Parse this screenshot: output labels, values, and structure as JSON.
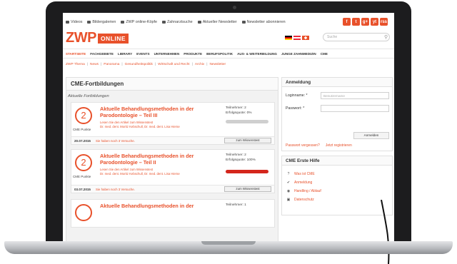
{
  "toplinks": [
    {
      "icon": "video-icon",
      "label": "Videos"
    },
    {
      "icon": "camera-icon",
      "label": "Bildergalerien"
    },
    {
      "icon": "user-icon",
      "label": "ZWP online-Köpfe"
    },
    {
      "icon": "search-icon",
      "label": "Zahnarztsuche"
    },
    {
      "icon": "mail-icon",
      "label": "Aktueller Newsletter"
    },
    {
      "icon": "mail-icon",
      "label": "Newsletter abonnieren"
    }
  ],
  "socials": [
    "f",
    "t",
    "g+",
    "yt",
    "rss"
  ],
  "logo": {
    "text": "ZWP",
    "badge": "ONLINE"
  },
  "search": {
    "placeholder": "Suche"
  },
  "nav": {
    "active": "STARTSEITE",
    "items": [
      "FACHGEBIETE",
      "LIBRARY",
      "EVENTS",
      "UNTERNEHMEN",
      "PRODUKTE",
      "BERUFSPOLITIK",
      "AUS- & WEITERBILDUNG",
      "JUNGE ZAHNMEDIZIN",
      "CME"
    ]
  },
  "subnav": [
    "ZWP Thema",
    "News",
    "Panorama",
    "Gesundheitspolitik",
    "Wirtschaft und Recht",
    "Archiv",
    "Newsletter"
  ],
  "main": {
    "title": "CME-Fortbildungen",
    "subtitle": "Aktuelle Fortbildungen"
  },
  "courses": [
    {
      "points": "2",
      "points_label": "CME Punkte",
      "title": "Aktuelle Behandlungsmethoden in der Parodontologie – Teil III",
      "link": "Lesen Sie den Artikel zum Wissenstest",
      "authors": "Dr. med. dent. Moritz Kebschull, Dr. med. dent. Lisa Hierse",
      "participants": "Teilnehmer: 2",
      "success": "Erfolgsquote: 0%",
      "success_value": 0,
      "date": "20.07.2015",
      "tries": "Sie haben noch 3 Versuche.",
      "button": "zum Wissenstest"
    },
    {
      "points": "2",
      "points_label": "CME Punkte",
      "title": "Aktuelle Behandlungsmethoden in der Parodontologie – Teil II",
      "link": "Lesen Sie den Artikel zum Wissenstest",
      "authors": "Dr. med. dent. Moritz Kebschull, Dr. med. dent. Lisa Hierse",
      "participants": "Teilnehmer: 2",
      "success": "Erfolgsquote: 100%",
      "success_value": 100,
      "date": "03.07.2015",
      "tries": "Sie haben noch 3 Versuche.",
      "button": "zum Wissenstest"
    },
    {
      "points": "",
      "points_label": "",
      "title": "Aktuelle Behandlungsmethoden in der",
      "link": "",
      "authors": "",
      "participants": "Teilnehmer: 1",
      "success": "",
      "date": "",
      "tries": "",
      "button": ""
    }
  ],
  "login": {
    "title": "Anmeldung",
    "login_label": "Loginname: *",
    "login_placeholder": "Benutzername",
    "password_label": "Passwort: *",
    "button": "Anmelden",
    "forgot": "Passwort vergessen?",
    "register": "Jetzt registrieren"
  },
  "help": {
    "title": "CME Erste Hilfe",
    "items": [
      "Was ist CME",
      "Anmeldung",
      "Handling / Ablauf",
      "Datenschutz"
    ]
  },
  "colors": {
    "accent": "#e8512b",
    "progress": "#d4261c"
  }
}
